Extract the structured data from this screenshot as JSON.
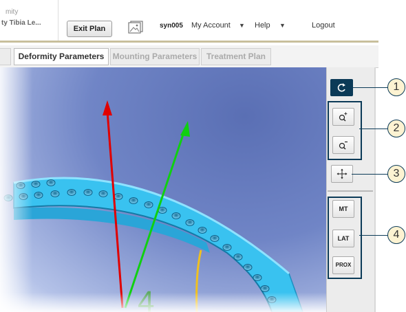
{
  "header": {
    "plan_title_line1": "mity",
    "plan_title_line2": "ty Tibia Le...",
    "exit_button": "Exit Plan",
    "user": "syn005",
    "account_menu": "My Account",
    "account_caret": "▼",
    "help_menu": "Help",
    "help_caret": "▼",
    "logout": "Logout"
  },
  "tabs": [
    {
      "label": ""
    },
    {
      "label": "Deformity Parameters"
    },
    {
      "label": "Mounting Parameters"
    },
    {
      "label": "Treatment Plan"
    }
  ],
  "toolbar": {
    "reset_icon": "rotate-reset-icon",
    "zoom_in_icon": "zoom-in-icon",
    "zoom_out_icon": "zoom-out-icon",
    "pan_icon": "pan-move-icon",
    "view_buttons": [
      {
        "label": "MT"
      },
      {
        "label": "LAT"
      },
      {
        "label": "PROX"
      }
    ]
  },
  "callouts": [
    {
      "label": "1"
    },
    {
      "label": "2"
    },
    {
      "label": "3"
    },
    {
      "label": "4"
    }
  ],
  "scene": {
    "marker_digit": "4"
  },
  "colors": {
    "header_rule": "#c8bf9c",
    "toolbar_accent": "#0b3a57",
    "callout_fill": "#fdf3d2",
    "ring": "#39c2f0",
    "axis_red": "#e00000",
    "axis_green": "#10d010",
    "axis_yellow": "#f0c020"
  }
}
